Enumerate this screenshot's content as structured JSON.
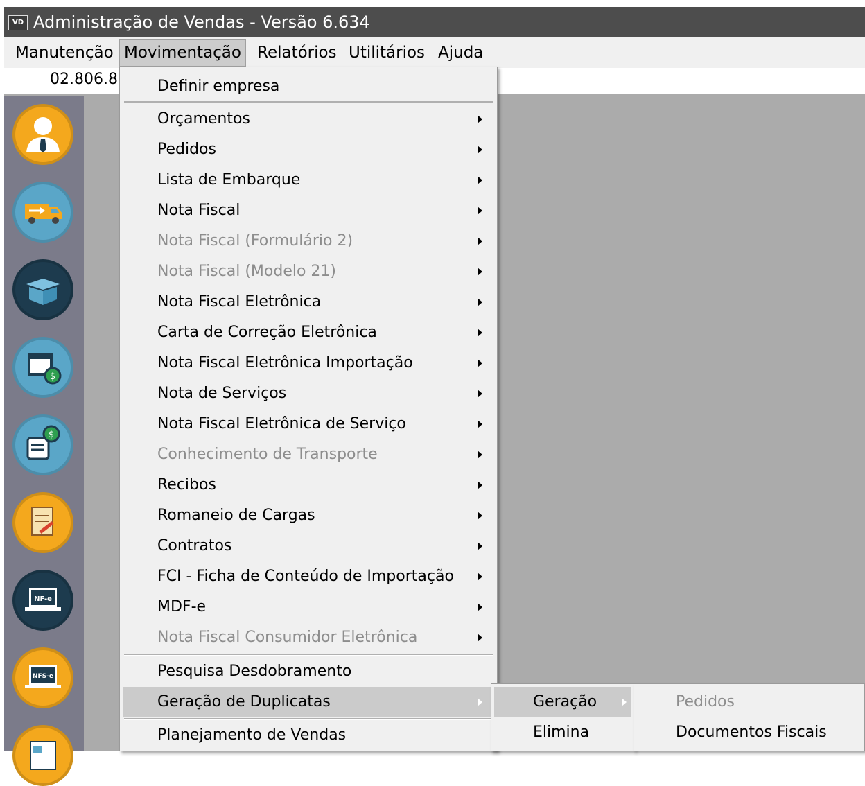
{
  "window": {
    "app_icon": "VD",
    "title": "Administração de Vendas - Versão 6.634"
  },
  "menubar": {
    "items": [
      "Manutenção",
      "Movimentação",
      "Relatórios",
      "Utilitários",
      "Ajuda"
    ],
    "active": "Movimentação"
  },
  "header": {
    "code_text": "02.806.8"
  },
  "sidebar": {
    "icons": [
      "user-icon",
      "delivery-truck-icon",
      "box-icon",
      "calendar-money-icon",
      "document-money-icon",
      "signed-document-icon",
      "nf-e-icon",
      "nfs-e-icon",
      "newspaper-icon"
    ],
    "labels": {
      "nf_e": "NF-e",
      "nfs_e": "NFS-e"
    }
  },
  "movimentacao_menu": {
    "items": [
      {
        "label": "Definir empresa",
        "submenu": false,
        "disabled": false
      },
      {
        "label": "Orçamentos",
        "submenu": true,
        "disabled": false
      },
      {
        "label": "Pedidos",
        "submenu": true,
        "disabled": false
      },
      {
        "label": "Lista de Embarque",
        "submenu": true,
        "disabled": false
      },
      {
        "label": "Nota Fiscal",
        "submenu": true,
        "disabled": false
      },
      {
        "label": "Nota Fiscal (Formulário 2)",
        "submenu": true,
        "disabled": true
      },
      {
        "label": "Nota Fiscal (Modelo 21)",
        "submenu": true,
        "disabled": true
      },
      {
        "label": "Nota Fiscal Eletrônica",
        "submenu": true,
        "disabled": false
      },
      {
        "label": "Carta de Correção Eletrônica",
        "submenu": true,
        "disabled": false
      },
      {
        "label": "Nota Fiscal Eletrônica Importação",
        "submenu": true,
        "disabled": false
      },
      {
        "label": "Nota de Serviços",
        "submenu": true,
        "disabled": false
      },
      {
        "label": "Nota Fiscal Eletrônica de Serviço",
        "submenu": true,
        "disabled": false
      },
      {
        "label": "Conhecimento de Transporte",
        "submenu": true,
        "disabled": true
      },
      {
        "label": "Recibos",
        "submenu": true,
        "disabled": false
      },
      {
        "label": "Romaneio de Cargas",
        "submenu": true,
        "disabled": false
      },
      {
        "label": "Contratos",
        "submenu": true,
        "disabled": false
      },
      {
        "label": "FCI - Ficha de Conteúdo de Importação",
        "submenu": true,
        "disabled": false
      },
      {
        "label": "MDF-e",
        "submenu": true,
        "disabled": false
      },
      {
        "label": "Nota Fiscal Consumidor Eletrônica",
        "submenu": true,
        "disabled": true
      },
      {
        "label": "Pesquisa Desdobramento",
        "submenu": false,
        "disabled": false
      },
      {
        "label": "Geração de Duplicatas",
        "submenu": true,
        "disabled": false,
        "highlighted": true
      },
      {
        "label": "Planejamento de Vendas",
        "submenu": false,
        "disabled": false
      }
    ]
  },
  "duplicatas_submenu": {
    "items": [
      {
        "label": "Geração",
        "submenu": true,
        "highlighted": true
      },
      {
        "label": "Elimina",
        "submenu": false
      }
    ]
  },
  "geracao_submenu": {
    "items": [
      {
        "label": "Pedidos",
        "disabled": true
      },
      {
        "label": "Documentos Fiscais",
        "disabled": false
      }
    ]
  }
}
